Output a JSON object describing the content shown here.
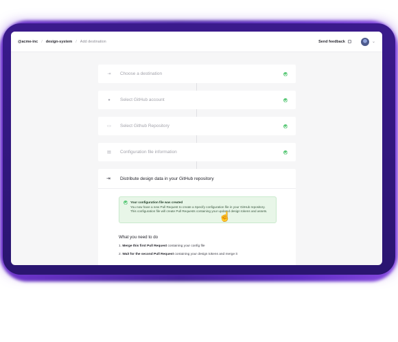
{
  "colors": {
    "accent_purple": "#5b2bc0",
    "success_green": "#5cc979",
    "alert_bg": "#e8f6e8"
  },
  "breadcrumb": {
    "org": "@acme-inc",
    "project": "design-system",
    "page": "Add destination"
  },
  "header": {
    "feedback_label": "Send feedback",
    "feedback_icon": "external-link-icon",
    "avatar_icon": "user-avatar",
    "menu_icon": "chevron-down-icon"
  },
  "steps": [
    {
      "label": "Choose a destination",
      "icon": "arrow-out-icon",
      "status": "done"
    },
    {
      "label": "Select GitHub account",
      "icon": "github-icon",
      "status": "done"
    },
    {
      "label": "Select Github Repository",
      "icon": "folder-icon",
      "status": "done"
    },
    {
      "label": "Configuration file information",
      "icon": "file-icon",
      "status": "done"
    }
  ],
  "active_step": {
    "title": "Distribute design data in your GitHub repository",
    "icon": "distribute-icon",
    "alert": {
      "title": "Your configuration file was created",
      "body": "You now have a new Pull Request to create a Specify configuration file in your GitHub repository. This configuration file will create Pull Requests containing your updated design tokens and assets."
    },
    "todo_title": "What you need to do",
    "todo": [
      {
        "num": "1.",
        "bold": "Merge this first Pull Request",
        "rest": " containing your config file"
      },
      {
        "num": "2.",
        "bold": "Wait for the second Pull Request",
        "rest": " containing your design tokens and merge it"
      }
    ]
  }
}
